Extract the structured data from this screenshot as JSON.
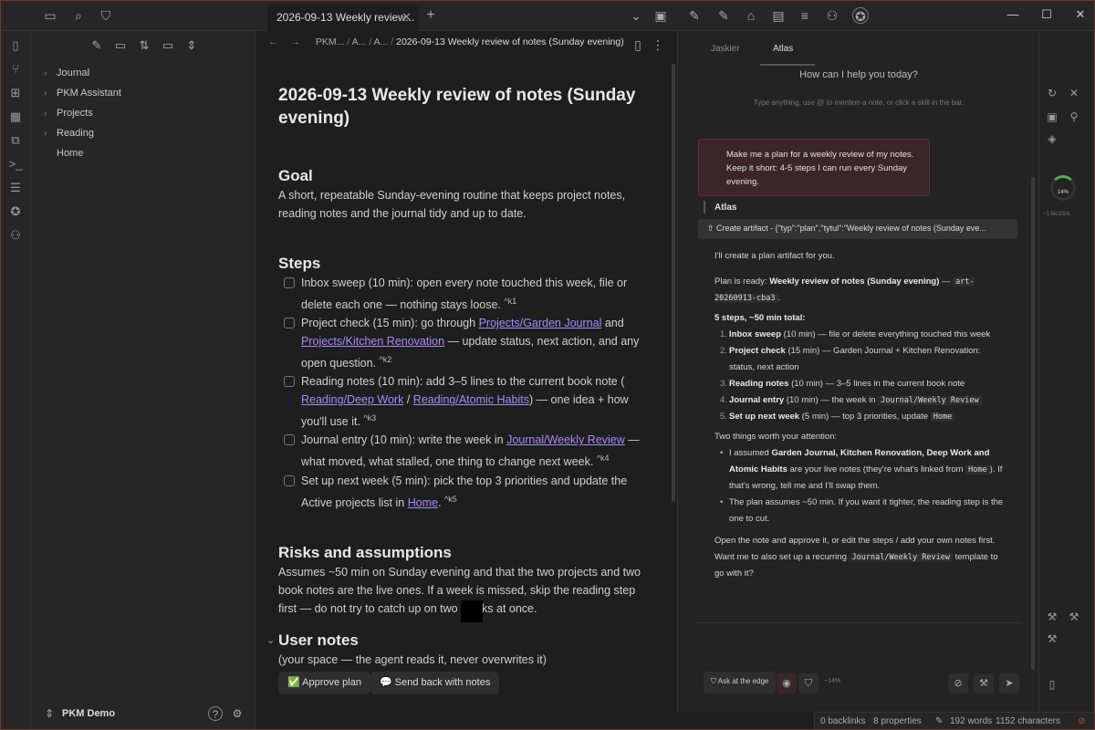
{
  "tab": {
    "title": "2026-09-13 Weekly review...",
    "close": "✕",
    "new": "+"
  },
  "window": {
    "minimize": "—",
    "maximize": "☐",
    "close": "✕"
  },
  "sidebar": {
    "tree": [
      {
        "label": "Journal",
        "chevron": "›"
      },
      {
        "label": "PKM Assistant",
        "chevron": "›"
      },
      {
        "label": "Projects",
        "chevron": "›"
      },
      {
        "label": "Reading",
        "chevron": "›"
      },
      {
        "label": "Home",
        "chevron": ""
      }
    ],
    "vault": "PKM Demo"
  },
  "editor": {
    "crumbs": {
      "c1": "PKM...",
      "c2": "A...",
      "c3": "A...",
      "current": "2026-09-13 Weekly review of notes (Sunday evening)"
    },
    "title": "2026-09-13 Weekly review of notes (Sunday evening)",
    "goal_heading": "Goal",
    "goal_text": "A short, repeatable Sunday-evening routine that keeps project notes, reading notes and the journal tidy and up to date.",
    "steps_heading": "Steps",
    "steps": {
      "s1_text": "Inbox sweep (10 min): open every note touched this week, file or delete each one — nothing stays loose.",
      "s1_ref": "^k1",
      "s2_a": "Project check (15 min): go through",
      "s2_link1": "Projects/Garden Journal",
      "s2_and": "and",
      "s2_link2": "Projects/Kitchen Renovation",
      "s2_b": "— update status, next action, and any open question.",
      "s2_ref": "^k2",
      "s3_a": "Reading notes (10 min): add 3–5 lines to the current book note (",
      "s3_link1": "Reading/Deep Work",
      "s3_sep": "/",
      "s3_link2": "Reading/Atomic Habits",
      "s3_b": ") — one idea + how you'll use it.",
      "s3_ref": "^k3",
      "s4_a": "Journal entry (10 min): write the week in",
      "s4_link": "Journal/Weekly Review",
      "s4_b": "— what moved, what stalled, one thing to change next week.",
      "s4_ref": "^k4",
      "s5_a": "Set up next week (5 min): pick the top 3 priorities and update the Active projects list in",
      "s5_link": "Home",
      "s5_b": ".",
      "s5_ref": "^k5"
    },
    "risks_heading": "Risks and assumptions",
    "risks_text": "Assumes ~50 min on Sunday evening and that the two projects and two book notes are the live ones. If a week is missed, skip the reading step first — do not try to catch up on two weeks at once.",
    "user_heading": "User notes",
    "user_text": "(your space — the agent reads it, never overwrites it)",
    "approve_button": "✅ Approve plan",
    "sendback_button": "💬 Send back with notes"
  },
  "chat": {
    "tab1": "Jaskier",
    "tab2": "Atlas",
    "help": "How can I help you today?",
    "hint": "Type anything, use @ to mention a note, or click a skill in the bar.",
    "user_message": "Make me a plan for a weekly review of my notes. Keep it short: 4-5 steps I can run every Sunday evening.",
    "agent": "Atlas",
    "artifact": "⇧  Create artifact - {\"typ\":\"plan\",\"tytul\":\"Weekly review of notes (Sunday eve...",
    "r1": "I'll create a plan artifact for you.",
    "r2_a": "Plan is ready:",
    "r2_b": "Weekly review of notes (Sunday evening)",
    "r2_c": "—",
    "r2_code": "art-20260913-cba3",
    "r2_d": ".",
    "r3": "5 steps, ~50 min total:",
    "list": {
      "l1_b": "Inbox sweep",
      "l1_t": "(10 min) — file or delete everything touched this week",
      "l2_b": "Project check",
      "l2_t": "(15 min) — Garden Journal + Kitchen Renovation: status, next action",
      "l3_b": "Reading notes",
      "l3_t": "(10 min) — 3–5 lines in the current book note",
      "l4_b": "Journal entry",
      "l4_t": "(10 min) — the week in",
      "l4_code": "Journal/Weekly Review",
      "l5_b": "Set up next week",
      "l5_t": "(5 min) — top 3 priorities, update",
      "l5_code": "Home"
    },
    "attn": "Two things worth your attention:",
    "b1_a": "I assumed",
    "b1_b": "Garden Journal, Kitchen Renovation, Deep Work and Atomic Habits",
    "b1_c": "are your live notes (they're what's linked from",
    "b1_code": "Home",
    "b1_d": "). If that's wrong, tell me and I'll swap them.",
    "b2": "The plan assumes ~50 min. If you want it tighter, the reading step is the one to cut.",
    "closing_a": "Open the note and approve it, or edit the steps / add your own notes first. Want me to also set up a recurring",
    "closing_code": "Journal/Weekly Review",
    "closing_b": "template to go with it?",
    "ask_pill": "⛉  Ask at the edge",
    "pct": "~14%"
  },
  "rail": {
    "gauge": "14%",
    "tokens": "~1.6k/100k"
  },
  "status": {
    "backlinks": "0 backlinks",
    "properties": "8 properties",
    "words": "192 words",
    "chars": "1152 characters"
  },
  "colors": {
    "accent": "#a78bfa",
    "frame": "#6b3b2e",
    "user_bubble": "#3a262a"
  }
}
